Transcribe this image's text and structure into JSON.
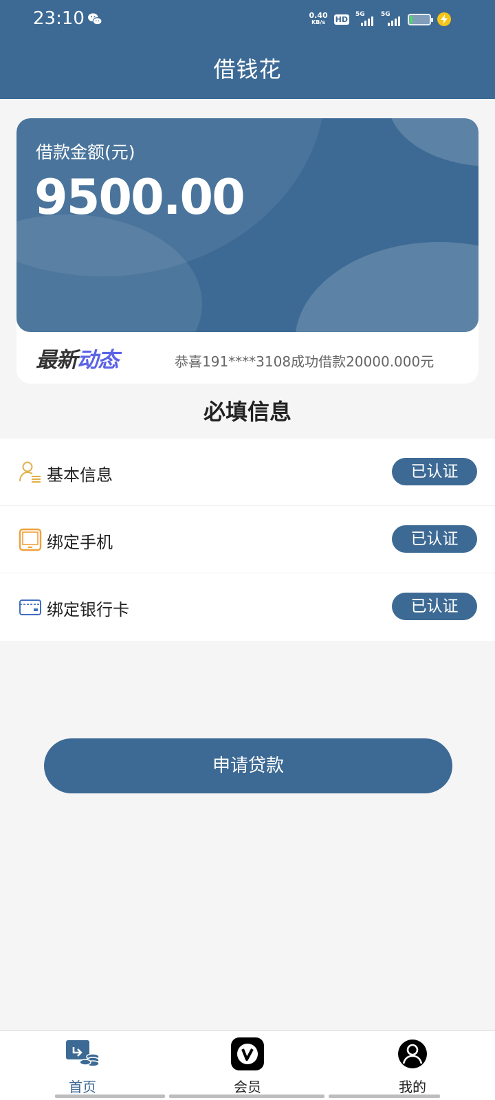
{
  "status_bar": {
    "time": "23:10",
    "net_speed_value": "0.40",
    "net_speed_unit": "KB/s",
    "hd_label": "HD",
    "sim1_label": "5G",
    "sim2_label": "5G",
    "battery_level": 0.15,
    "charging": true,
    "icons": [
      "wechat-icon",
      "hd-icon",
      "signal-icon",
      "battery-icon",
      "charging-icon"
    ]
  },
  "header": {
    "title": "借钱花"
  },
  "loan_card": {
    "amount_label": "借款金额(元)",
    "amount_value": "9500.00",
    "news_logo_part1": "最新",
    "news_logo_part2": "动态",
    "news_text": "恭喜191****3108成功借款20000.000元"
  },
  "required_info": {
    "title": "必填信息",
    "items": [
      {
        "label": "基本信息",
        "status": "已认证",
        "icon": "user-info-icon"
      },
      {
        "label": "绑定手机",
        "status": "已认证",
        "icon": "tablet-icon"
      },
      {
        "label": "绑定银行卡",
        "status": "已认证",
        "icon": "bank-card-icon"
      }
    ]
  },
  "apply_button": {
    "label": "申请贷款"
  },
  "tabbar": {
    "items": [
      {
        "label": "首页",
        "icon": "home-loan-icon",
        "active": true
      },
      {
        "label": "会员",
        "icon": "vip-icon",
        "active": false
      },
      {
        "label": "我的",
        "icon": "profile-icon",
        "active": false
      }
    ]
  },
  "colors": {
    "primary": "#3d6a94",
    "background": "#f5f5f6",
    "news_accent": "#5b63e6",
    "icon_gold": "#e0b04a",
    "icon_orange": "#f0a03a",
    "icon_blue": "#3f6fc0"
  }
}
